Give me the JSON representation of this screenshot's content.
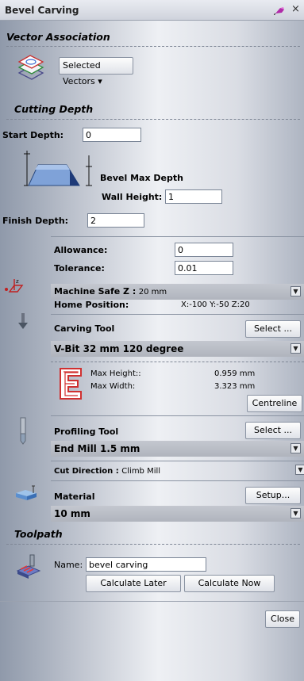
{
  "window": {
    "title": "Bevel Carving",
    "close_glyph": "×"
  },
  "vector_association": {
    "section_title": "Vector Association",
    "selector_label": "Selected Vectors",
    "arrow": "▾"
  },
  "cutting_depth": {
    "section_title": "Cutting Depth",
    "start_depth_label": "Start Depth:",
    "start_depth_value": "0",
    "bevel_max_depth_label": "Bevel Max Depth",
    "wall_height_label": "Wall Height:",
    "wall_height_value": "1",
    "finish_depth_label": "Finish Depth:",
    "finish_depth_value": "2"
  },
  "allowance": {
    "label": "Allowance:",
    "value": "0"
  },
  "tolerance": {
    "label": "Tolerance:",
    "value": "0.01"
  },
  "machine": {
    "safe_z_label": "Machine Safe Z :",
    "safe_z_value": "20 mm",
    "home_label": "Home Position:",
    "home_value": "X:-100 Y:-50 Z:20"
  },
  "carving_tool": {
    "label": "Carving Tool",
    "select_label": "Select ...",
    "tool_name": "V-Bit 32 mm 120 degree",
    "max_height_label": "Max Height::",
    "max_height_value": "0.959 mm",
    "max_width_label": "Max Width:",
    "max_width_value": "3.323 mm",
    "centreline_label": "Centreline"
  },
  "profiling_tool": {
    "label": "Profiling Tool",
    "select_label": "Select ...",
    "tool_name": "End Mill 1.5 mm",
    "cut_direction_label": "Cut Direction :",
    "cut_direction_value": "Climb Mill"
  },
  "material": {
    "label": "Material",
    "setup_label": "Setup...",
    "value": "10 mm"
  },
  "toolpath": {
    "section_title": "Toolpath",
    "name_label": "Name:",
    "name_value": "bevel carving",
    "calculate_later": "Calculate Later",
    "calculate_now": "Calculate Now",
    "close": "Close"
  },
  "icons": {
    "pin": "pin-icon",
    "close": "close-icon",
    "vectors": "vector-layers-icon",
    "bevel": "bevel-profile-icon",
    "safe_z": "safe-z-axis-icon",
    "carving": "carving-tool-icon",
    "letter": "letter-e-outline-icon",
    "profiling": "profiling-tool-icon",
    "material": "material-block-icon",
    "toolpath": "toolpath-icon"
  }
}
